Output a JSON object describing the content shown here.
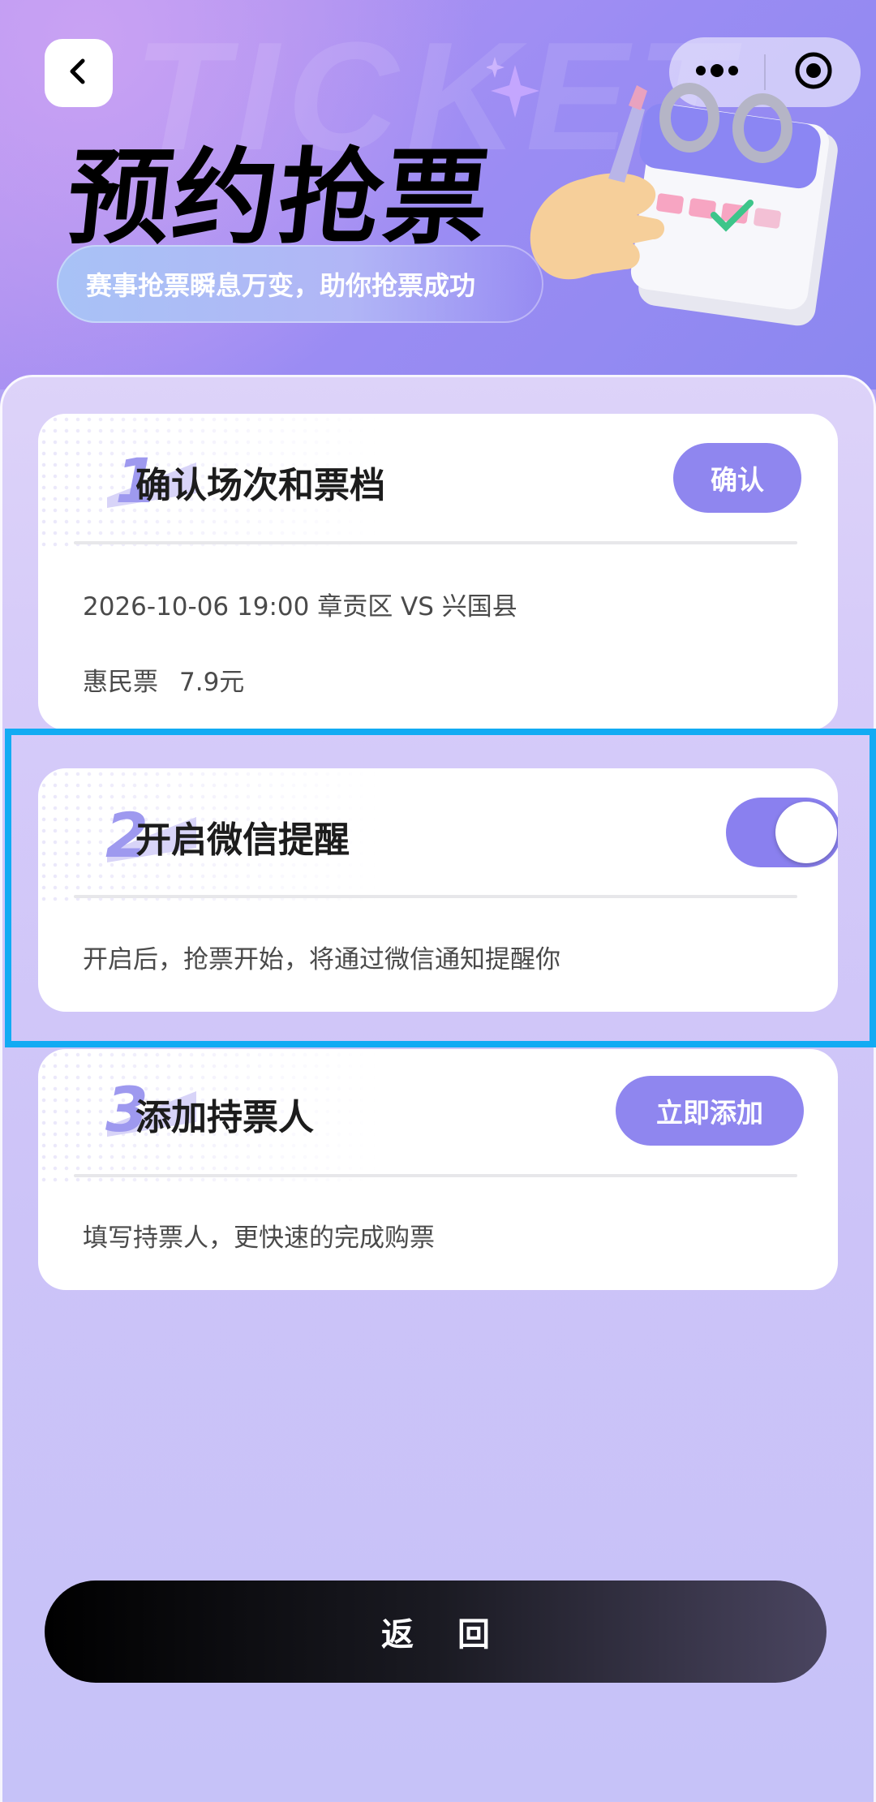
{
  "header": {
    "watermark": "TICKET",
    "title": "预约抢票",
    "subtitle": "赛事抢票瞬息万变，助你抢票成功"
  },
  "steps": [
    {
      "number": "1",
      "title": "确认场次和票档",
      "action_label": "确认",
      "match_info": "2026-10-06 19:00 章贡区 VS 兴国县",
      "ticket_type": "惠民票",
      "ticket_price": "7.9元"
    },
    {
      "number": "2",
      "title": "开启微信提醒",
      "toggle_on": true,
      "description": "开启后，抢票开始，将通过微信通知提醒你"
    },
    {
      "number": "3",
      "title": "添加持票人",
      "action_label": "立即添加",
      "description": "填写持票人，更快速的完成购票"
    }
  ],
  "footer": {
    "return_label": "返 回"
  },
  "icons": {
    "back": "chevron-left-icon",
    "more": "more-dots-icon",
    "close": "target-circle-icon"
  },
  "colors": {
    "accent": "#8f86ef",
    "highlight": "#12abf3"
  }
}
